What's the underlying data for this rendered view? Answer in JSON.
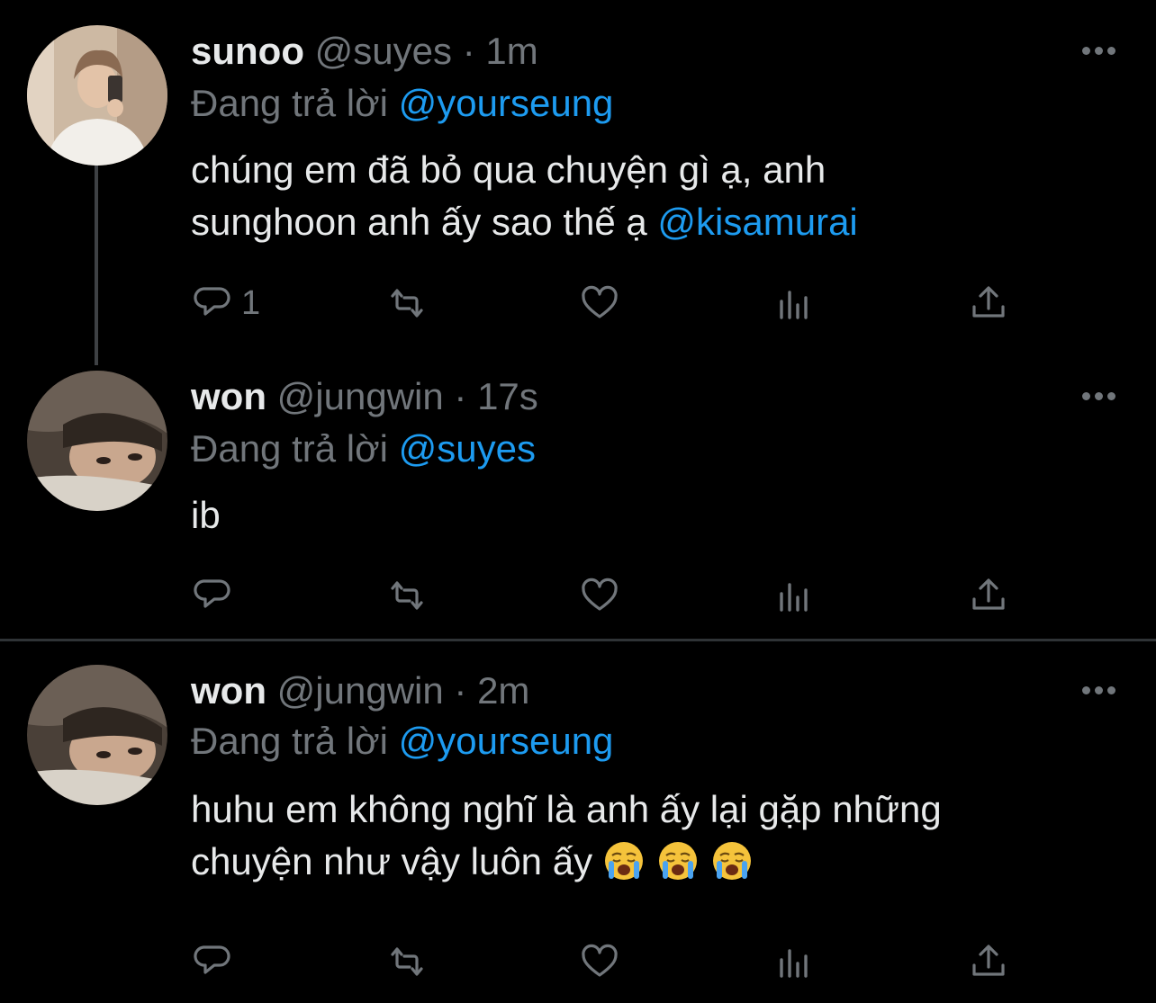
{
  "tweets": [
    {
      "display_name": "sunoo",
      "handle": "@suyes",
      "separator": "·",
      "time": "1m",
      "replying_prefix": "Đang trả lời ",
      "replying_to": "@yourseung",
      "text_line1": "chúng em đã bỏ qua chuyện gì ạ, anh",
      "text_line2_prefix": "sunghoon anh ấy sao thế ạ ",
      "text_line2_mention": "@kisamurai",
      "reply_count": "1"
    },
    {
      "display_name": "won",
      "handle": "@jungwin",
      "separator": "·",
      "time": "17s",
      "replying_prefix": "Đang trả lời ",
      "replying_to": "@suyes",
      "text_line1": "ib",
      "reply_count": ""
    },
    {
      "display_name": "won",
      "handle": "@jungwin",
      "separator": "·",
      "time": "2m",
      "replying_prefix": "Đang trả lời ",
      "replying_to": "@yourseung",
      "text_line1": "huhu em không nghĩ là anh ấy lại gặp những",
      "text_line2_prefix": "chuyện như vậy luôn ấy",
      "emojis": [
        "loudly-crying-face",
        "loudly-crying-face",
        "loudly-crying-face"
      ],
      "reply_count": ""
    }
  ],
  "action_icons": [
    "reply-icon",
    "retweet-icon",
    "like-icon",
    "analytics-icon",
    "share-icon"
  ],
  "colors": {
    "background": "#000000",
    "text": "#e7e9ea",
    "muted": "#71767b",
    "link": "#1d9bf0",
    "divider": "#2f3336"
  }
}
